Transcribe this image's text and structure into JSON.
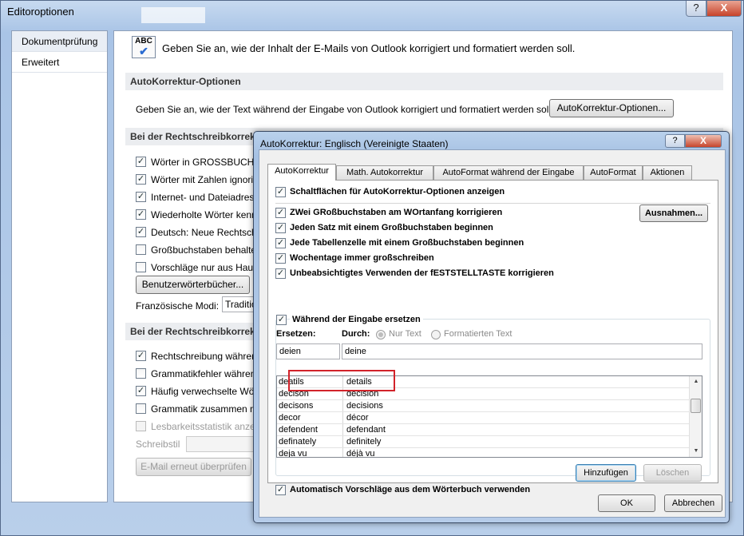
{
  "window": {
    "title": "Editoroptionen",
    "help_btn": "?",
    "close_btn": "X"
  },
  "sidebar": {
    "items": [
      {
        "label": "Dokumentprüfung"
      },
      {
        "label": "Erweitert"
      }
    ]
  },
  "main": {
    "intro_icon": "ABC",
    "intro": "Geben Sie an, wie der Inhalt der E-Mails von Outlook korrigiert und formatiert werden soll.",
    "ac_header": "AutoKorrektur-Optionen",
    "ac_text": "Geben Sie an, wie der Text während der Eingabe von Outlook korrigiert und formatiert werden soll.",
    "ac_button": "AutoKorrektur-Optionen...",
    "spell_header": "Bei der Rechtschreibkorrekt",
    "spell_items": [
      {
        "label": "Wörter in GROSSBUCHST",
        "checked": "✓"
      },
      {
        "label": "Wörter mit Zahlen ignori",
        "checked": "✓"
      },
      {
        "label": "Internet- und Dateiadress",
        "checked": "✓"
      },
      {
        "label": "Wiederholte Wörter kenn",
        "checked": "✓"
      },
      {
        "label": "Deutsch: Neue Rechtschr",
        "checked": "✓"
      },
      {
        "label": "Großbuchstaben behalte",
        "checked": ""
      },
      {
        "label": "Vorschläge nur aus Haup",
        "checked": ""
      }
    ],
    "dict_button": "Benutzerwörterbücher...",
    "french_label": "Französische Modi:",
    "french_value": "Traditio",
    "grammar_header": "Bei der Rechtschreibkorrekt",
    "grammar_items": [
      {
        "label": "Rechtschreibung währen",
        "checked": "✓"
      },
      {
        "label": "Grammatikfehler währen",
        "checked": ""
      },
      {
        "label": "Häufig verwechselte Wör",
        "checked": "✓"
      },
      {
        "label": "Grammatik zusammen m",
        "checked": ""
      },
      {
        "label": "Lesbarkeitsstatistik anzei",
        "checked": ""
      }
    ],
    "style_label": "Schreibstil",
    "recheck_button": "E-Mail erneut überprüfen"
  },
  "dialog": {
    "title": "AutoKorrektur: Englisch (Vereinigte Staaten)",
    "help_btn": "?",
    "close_btn": "X",
    "tabs": [
      {
        "label": "AutoKorrektur"
      },
      {
        "label": "Math. Autokorrektur"
      },
      {
        "label": "AutoFormat während der Eingabe"
      },
      {
        "label": "AutoFormat"
      },
      {
        "label": "Aktionen"
      }
    ],
    "show_buttons": "Schaltflächen für AutoKorrektur-Optionen anzeigen",
    "options": [
      {
        "label": "ZWei GRoßbuchstaben am WOrtanfang korrigieren"
      },
      {
        "label": "Jeden Satz mit einem Großbuchstaben beginnen"
      },
      {
        "label": "Jede Tabellenzelle mit einem Großbuchstaben beginnen"
      },
      {
        "label": "Wochentage immer großschreiben"
      },
      {
        "label": "Unbeabsichtigtes Verwenden der fESTSTELLTASTE korrigieren"
      }
    ],
    "exceptions_button": "Ausnahmen...",
    "replace_while_typing": "Während der Eingabe ersetzen",
    "replace_label": "Ersetzen:",
    "with_label": "Durch:",
    "radio_plain": "Nur Text",
    "radio_formatted": "Formatierten Text",
    "replace_value": "deien",
    "with_value": "deine",
    "entries": [
      {
        "from": "deatils",
        "to": "details"
      },
      {
        "from": "decison",
        "to": "decision"
      },
      {
        "from": "decisons",
        "to": "decisions"
      },
      {
        "from": "decor",
        "to": "décor"
      },
      {
        "from": "defendent",
        "to": "defendant"
      },
      {
        "from": "definately",
        "to": "definitely"
      },
      {
        "from": "deja vu",
        "to": "déjà vu"
      }
    ],
    "add_button": "Hinzufügen",
    "delete_button": "Löschen",
    "auto_suggest": "Automatisch Vorschläge aus dem Wörterbuch verwenden",
    "ok_button": "OK",
    "cancel_button": "Abbrechen"
  }
}
